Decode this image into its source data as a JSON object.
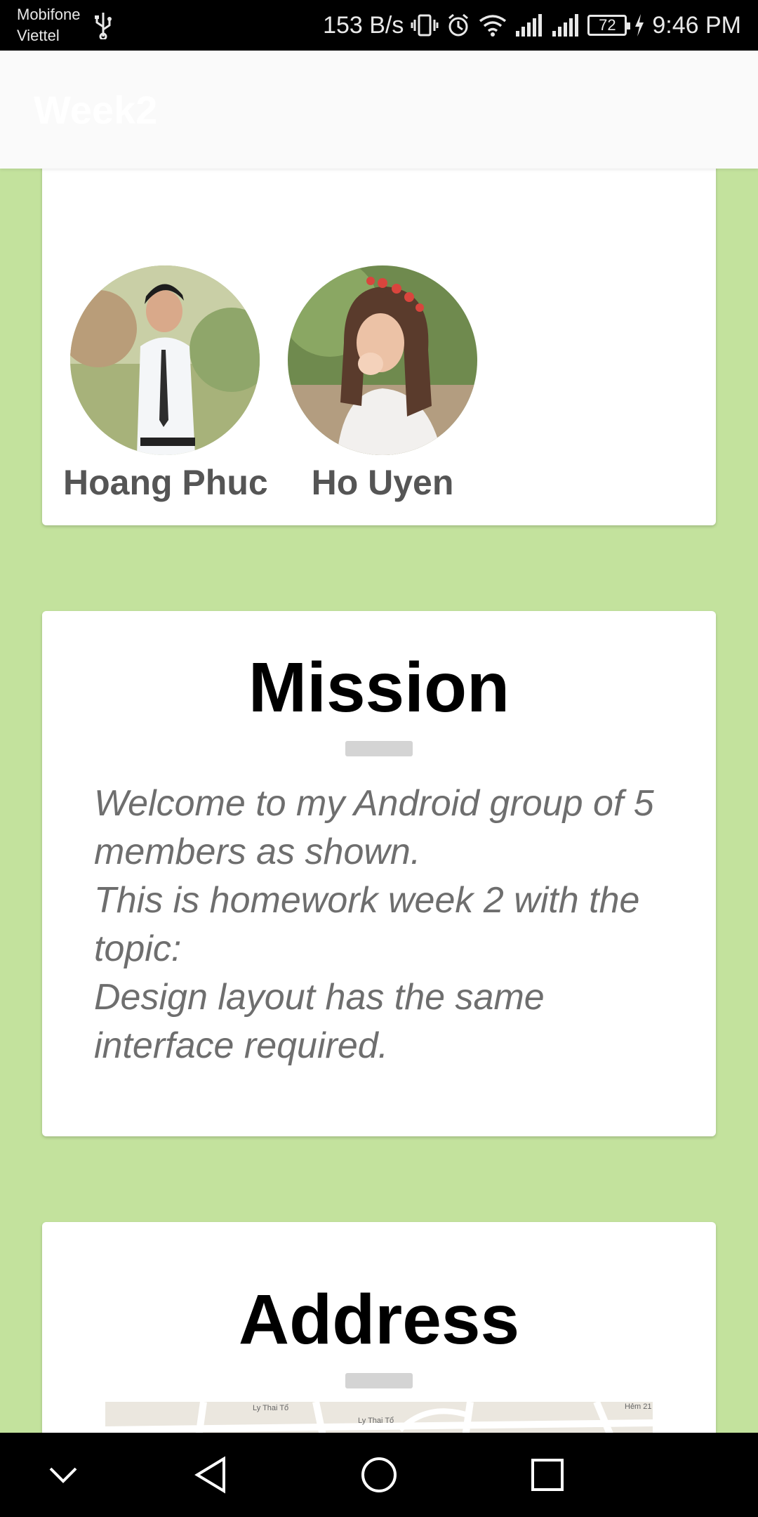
{
  "status_bar": {
    "carrier_1": "Mobifone",
    "carrier_2": "Viettel",
    "network_speed": "153 B/s",
    "battery_level": "72",
    "time": "9:46 PM"
  },
  "app_bar": {
    "title": "Week2"
  },
  "team": {
    "members": [
      {
        "name": "Hoang Phuc"
      },
      {
        "name": "Ho Uyen"
      }
    ]
  },
  "mission": {
    "title": "Mission",
    "text": "Welcome to my Android group of 5 members as shown.\n This is homework week 2 with the topic:\n Design layout has the same interface required."
  },
  "address": {
    "title": "Address",
    "map_labels": [
      "Ly Thai Tổ",
      "Ly Thai Tổ",
      "Hẻm 21"
    ]
  },
  "colors": {
    "background": "#c3e29d",
    "card": "#ffffff",
    "status_bar": "#000000",
    "app_bar": "#fafafa"
  }
}
